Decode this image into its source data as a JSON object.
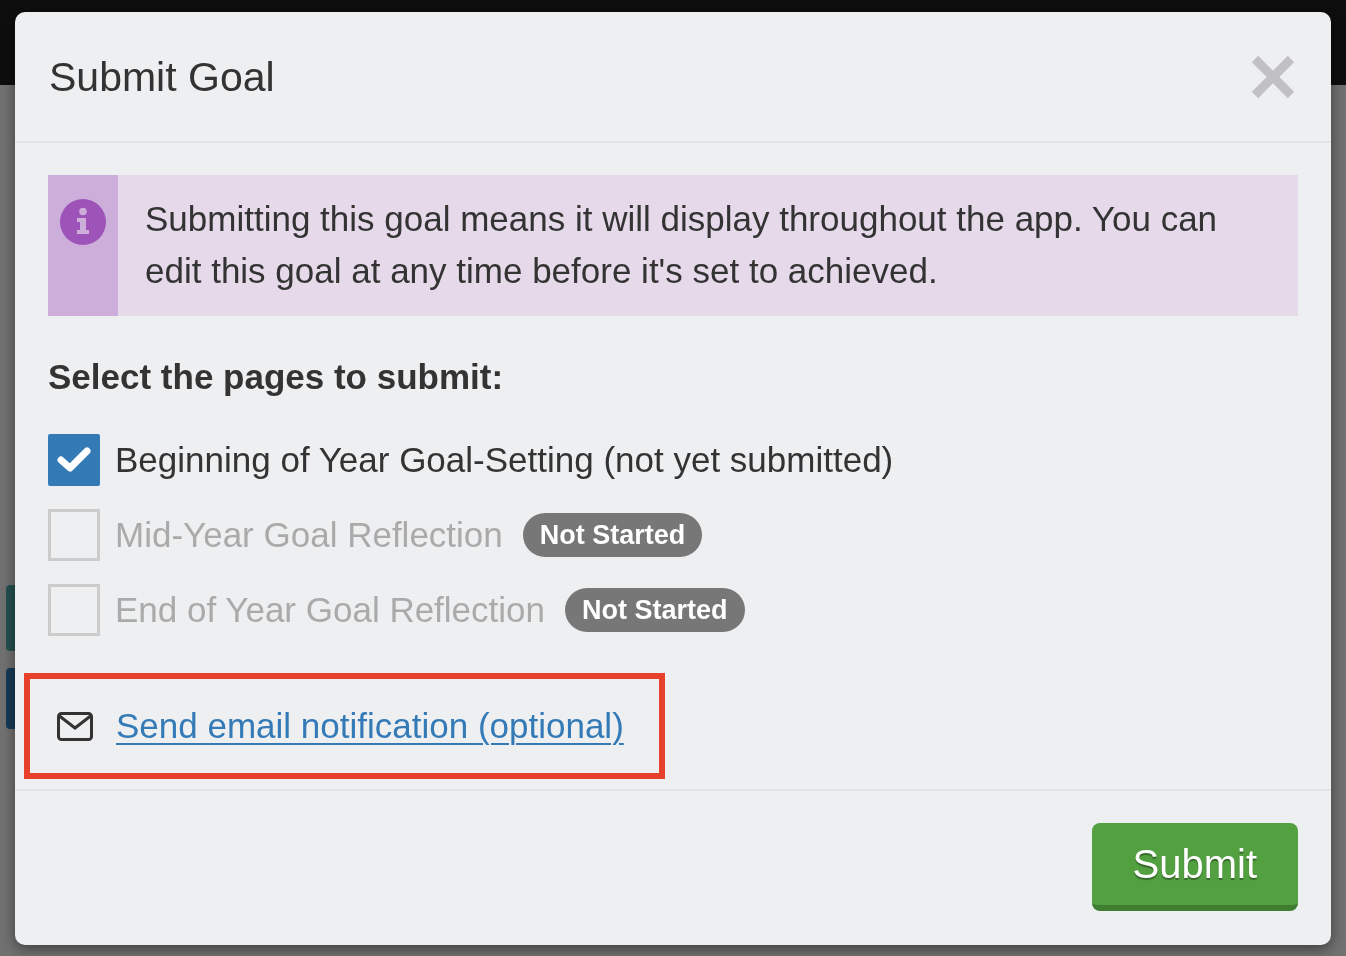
{
  "dialog": {
    "title": "Submit Goal",
    "alert": {
      "text": "Submitting this goal means it will display throughout the app. You can edit this goal at any time before it's set to achieved."
    },
    "pages_heading": "Select the pages to submit:",
    "pages": [
      {
        "label": "Beginning of Year Goal-Setting (not yet submitted)",
        "checked": true,
        "disabled": false
      },
      {
        "label": "Mid-Year Goal Reflection",
        "checked": false,
        "disabled": true,
        "badge": "Not Started"
      },
      {
        "label": "End of Year Goal Reflection",
        "checked": false,
        "disabled": true,
        "badge": "Not Started"
      }
    ],
    "email_link": {
      "label": "Send email notification (optional)",
      "highlighted": true
    },
    "submit_button": {
      "label": "Submit"
    }
  }
}
